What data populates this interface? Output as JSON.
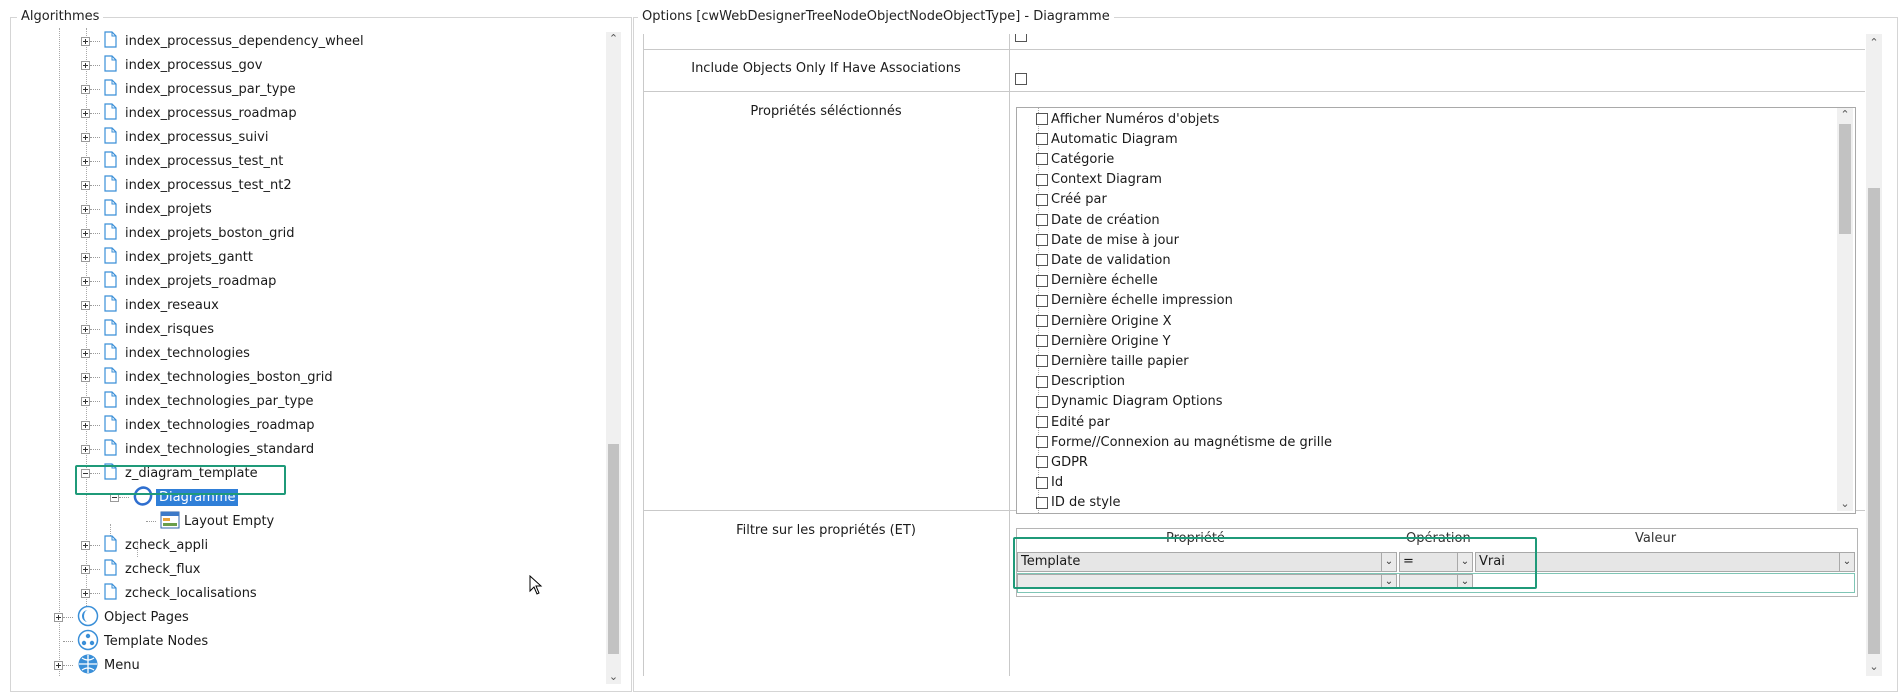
{
  "left_panel": {
    "title": "Algorithmes",
    "items": [
      {
        "label": "index_processus_dependency_wheel"
      },
      {
        "label": "index_processus_gov"
      },
      {
        "label": "index_processus_par_type"
      },
      {
        "label": "index_processus_roadmap"
      },
      {
        "label": "index_processus_suivi"
      },
      {
        "label": "index_processus_test_nt"
      },
      {
        "label": "index_processus_test_nt2"
      },
      {
        "label": "index_projets"
      },
      {
        "label": "index_projets_boston_grid"
      },
      {
        "label": "index_projets_gantt"
      },
      {
        "label": "index_projets_roadmap"
      },
      {
        "label": "index_reseaux"
      },
      {
        "label": "index_risques"
      },
      {
        "label": "index_technologies"
      },
      {
        "label": "index_technologies_boston_grid"
      },
      {
        "label": "index_technologies_par_type"
      },
      {
        "label": "index_technologies_roadmap"
      },
      {
        "label": "index_technologies_standard"
      },
      {
        "label": "z_diagram_template"
      },
      {
        "label": "Diagramme"
      },
      {
        "label": "Layout Empty"
      },
      {
        "label": "zcheck_appli"
      },
      {
        "label": "zcheck_flux"
      },
      {
        "label": "zcheck_localisations"
      },
      {
        "label": "Object Pages"
      },
      {
        "label": "Template Nodes"
      },
      {
        "label": "Menu"
      }
    ]
  },
  "right_panel": {
    "title": "Options [cwWebDesignerTreeNodeObjectNodeObjectType] - Diagramme",
    "include_label": "Include Objects Only If Have Associations",
    "selected_props_label": "Propriétés séléctionnés",
    "properties": [
      "Afficher Numéros d'objets",
      "Automatic Diagram",
      "Catégorie",
      "Context Diagram",
      "Créé par",
      "Date de création",
      "Date de mise à jour",
      "Date de validation",
      "Dernière échelle",
      "Dernière échelle impression",
      "Dernière Origine X",
      "Dernière Origine Y",
      "Dernière taille papier",
      "Description",
      "Dynamic Diagram Options",
      "Edité par",
      "Forme//Connexion au magnétisme de grille",
      "GDPR",
      "Id",
      "ID de style"
    ],
    "filter_label": "Filtre sur les propriétés (ET)",
    "filter_headers": {
      "property": "Propriété",
      "operation": "Opération",
      "value": "Valeur"
    },
    "filter_row": {
      "property": "Template",
      "operation": "=",
      "value": "Vrai"
    }
  },
  "colors": {
    "highlight_box": "#1f9a79",
    "selection": "#2f7fd8"
  }
}
